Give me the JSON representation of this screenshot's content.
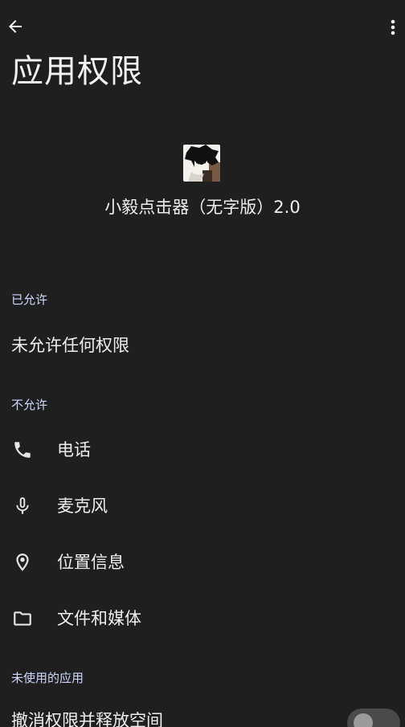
{
  "toolbar": {
    "back_icon": "arrow-back-icon",
    "more_icon": "more-vert-icon"
  },
  "page": {
    "title": "应用权限"
  },
  "app": {
    "name": "小毅点击器（无字版）2.0",
    "icon": "app-avatar-icon"
  },
  "sections": {
    "allowed": {
      "header": "已允许",
      "empty_text": "未允许任何权限"
    },
    "denied": {
      "header": "不允许",
      "items": [
        {
          "label": "电话",
          "icon": "phone-icon"
        },
        {
          "label": "麦克风",
          "icon": "microphone-icon"
        },
        {
          "label": "位置信息",
          "icon": "location-pin-icon"
        },
        {
          "label": "文件和媒体",
          "icon": "folder-icon"
        }
      ]
    },
    "unused": {
      "header": "未使用的应用",
      "toggle_label": "撤消权限并释放空间",
      "toggle_on": false
    }
  },
  "colors": {
    "background": "#1f1f1f",
    "section_header": "#cfd8ff",
    "text": "#efefef"
  }
}
